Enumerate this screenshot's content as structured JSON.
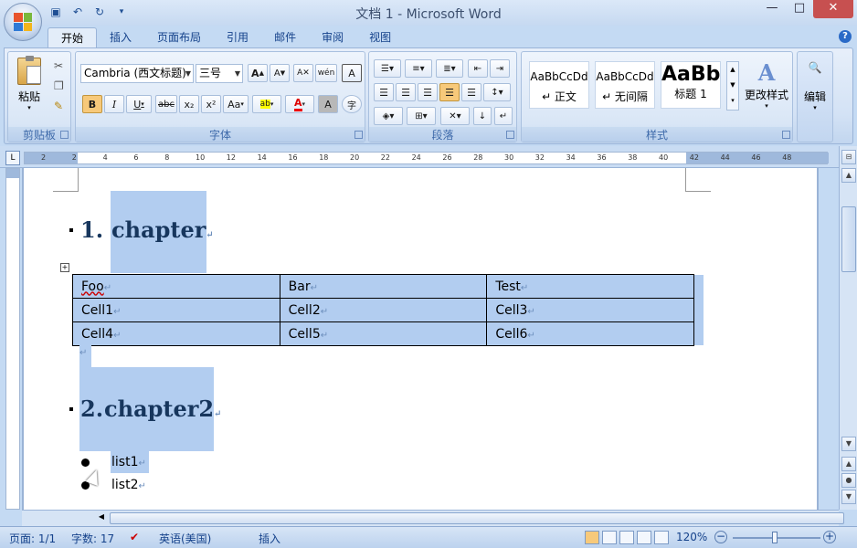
{
  "window": {
    "title": "文档 1 - Microsoft Word",
    "controls": [
      "—",
      "□",
      "✕"
    ]
  },
  "quick_access": [
    "save-icon",
    "undo-icon",
    "redo-icon",
    "customize-icon"
  ],
  "tabs": [
    {
      "label": "开始",
      "active": true
    },
    {
      "label": "插入"
    },
    {
      "label": "页面布局"
    },
    {
      "label": "引用"
    },
    {
      "label": "邮件"
    },
    {
      "label": "审阅"
    },
    {
      "label": "视图"
    }
  ],
  "ribbon": {
    "clipboard": {
      "label": "剪贴板",
      "paste": "粘贴"
    },
    "font": {
      "label": "字体",
      "font_name": "Cambria (西文标题)",
      "font_size": "三号",
      "grow": "A",
      "shrink": "A",
      "bold": "B",
      "italic": "I",
      "underline": "U",
      "strike": "abc",
      "sub": "x₂",
      "sup": "x²",
      "case": "Aa",
      "highlight": "ab",
      "color": "A",
      "charshade": "A",
      "enclose": "字"
    },
    "paragraph": {
      "label": "段落"
    },
    "styles": {
      "label": "样式",
      "items": [
        {
          "sample": "AaBbCcDd",
          "name": "↵ 正文"
        },
        {
          "sample": "AaBbCcDd",
          "name": "↵ 无间隔"
        },
        {
          "sample": "AaBb",
          "name": "标题 1"
        }
      ],
      "change": "更改样式"
    },
    "edit": {
      "label": "编辑"
    }
  },
  "ruler_numbers": [
    "2",
    "2",
    "4",
    "6",
    "8",
    "10",
    "12",
    "14",
    "16",
    "18",
    "20",
    "22",
    "24",
    "26",
    "28",
    "30",
    "32",
    "34",
    "36",
    "38",
    "40",
    "42",
    "44",
    "46",
    "48"
  ],
  "document": {
    "heading1": {
      "number": "1.",
      "text": "chapter"
    },
    "table": [
      [
        "Foo",
        "Bar",
        "Test"
      ],
      [
        "Cell1",
        "Cell2",
        "Cell3"
      ],
      [
        "Cell4",
        "Cell5",
        "Cell6"
      ]
    ],
    "heading2": {
      "number": "2.",
      "text": "chapter2"
    },
    "list": [
      "list1",
      "list2"
    ],
    "para_mark": "↵"
  },
  "status": {
    "page": "页面: 1/1",
    "words": "字数: 17",
    "language": "英语(美国)",
    "mode": "插入",
    "zoom": "120%"
  }
}
